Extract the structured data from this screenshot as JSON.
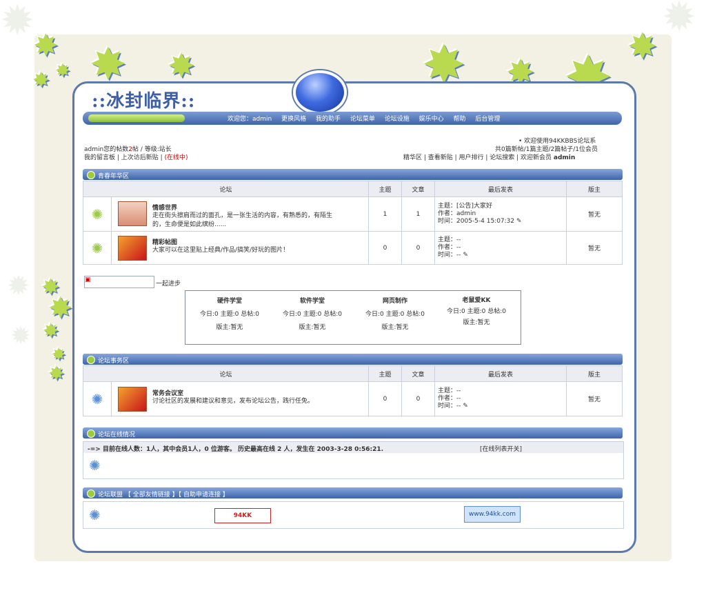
{
  "logo": {
    "title": "::冰封临界::"
  },
  "nav": {
    "items": [
      "欢迎您：admin",
      "更换风格",
      "我的助手",
      "论坛菜单",
      "论坛设施",
      "娱乐中心",
      "帮助",
      "后台管理"
    ]
  },
  "user_info": {
    "line1_a": "admin您的帖数",
    "line1_count": "2",
    "line1_b": "帖 / 等级:站长",
    "line2_a": "我的留言板 | 上次访后新贴 | ",
    "line2_status": "(在线中)"
  },
  "right_info": {
    "welcome": "• 欢迎使用94KKBBS论坛系",
    "stats": "共0篇新帖/1篇主题/2篇帖子/1位会员",
    "links": "精华区 | 查看新贴 | 用户排行 | 论坛搜索 | 欢迎新会员 ",
    "new_member": "admin"
  },
  "section1": {
    "title": "青春年华区",
    "headers": [
      "论坛",
      "主题",
      "文章",
      "最后发表",
      "版主"
    ],
    "rows": [
      {
        "name": "情感世界",
        "desc": "走在街头擦肩而过的面孔，是一张生活的内容，有熟悉的，有陌生的，生命便是如此缤纷......",
        "topics": "1",
        "posts": "1",
        "last_topic": "主题：[公告]大家好",
        "last_author": "作者：admin",
        "last_time": "时间：2005-5-4 15:07:32",
        "mod": "暂无"
      },
      {
        "name": "精彩帖图",
        "desc": "大家可以在这里贴上经典/作品/搞笑/好玩的图片！",
        "topics": "0",
        "posts": "0",
        "last_topic": "主题：--",
        "last_author": "作者：--",
        "last_time": "时间：--",
        "mod": "暂无"
      }
    ]
  },
  "group": {
    "label": "一起进步",
    "subs": [
      {
        "name": "硬件学堂",
        "stats": "今日:0 主题:0 总帖:0",
        "mod": "版主:暂无"
      },
      {
        "name": "软件学堂",
        "stats": "今日:0 主题:0 总帖:0",
        "mod": "版主:暂无"
      },
      {
        "name": "网页制作",
        "stats": "今日:0 主题:0 总帖:0",
        "mod": "版主:暂无"
      },
      {
        "name": "老鼠爱KK",
        "stats": "今日:0 主题:0 总帖:0",
        "mod": "版主:暂无"
      }
    ]
  },
  "section2": {
    "title": "论坛事务区",
    "headers": [
      "论坛",
      "主题",
      "文章",
      "最后发表",
      "版主"
    ],
    "rows": [
      {
        "name": "常务会议室",
        "desc": "讨论社区的发展和建议和意见，发布论坛公告，践行任免。",
        "topics": "0",
        "posts": "0",
        "last_topic": "主题：--",
        "last_author": "作者：--",
        "last_time": "时间：--",
        "mod": "暂无"
      }
    ]
  },
  "section3": {
    "title": "论坛在线情况",
    "line": "-=> 目前在线人数：1人，其中会员1人，0 位游客。 历史最高在线 2 人，发生在 2003-3-28 0:56:21.",
    "action": "[在线列表开关]"
  },
  "section4": {
    "title": "论坛联盟 【 全部友情链接 】【 自助申请连接 】",
    "link1": "94KK",
    "link2": "www.94kk.com"
  }
}
